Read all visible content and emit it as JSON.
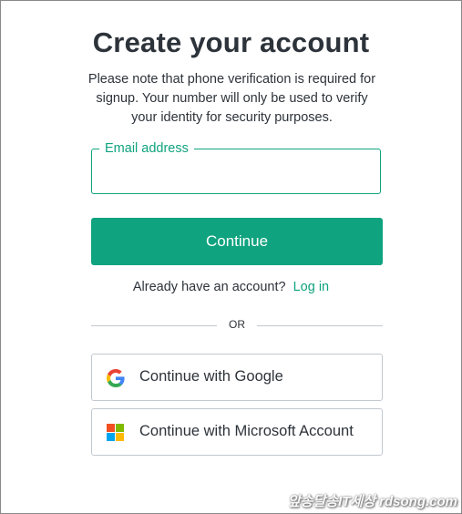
{
  "page": {
    "title": "Create your account",
    "note": "Please note that phone verification is required for signup. Your number will only be used to verify your identity for security purposes."
  },
  "email_field": {
    "label": "Email address",
    "value": "",
    "placeholder": ""
  },
  "continue_button": {
    "label": "Continue"
  },
  "login": {
    "prompt": "Already have an account?",
    "link": "Log in"
  },
  "divider": {
    "label": "OR"
  },
  "social": {
    "google": {
      "label": "Continue with Google",
      "icon": "google-icon"
    },
    "microsoft": {
      "label": "Continue with Microsoft Account",
      "icon": "microsoft-icon"
    }
  },
  "watermark": {
    "text": "앞송달송IT세상 rdsong.com"
  },
  "colors": {
    "accent": "#10a37f",
    "text": "#2d333a",
    "border": "#c2c8d0"
  }
}
